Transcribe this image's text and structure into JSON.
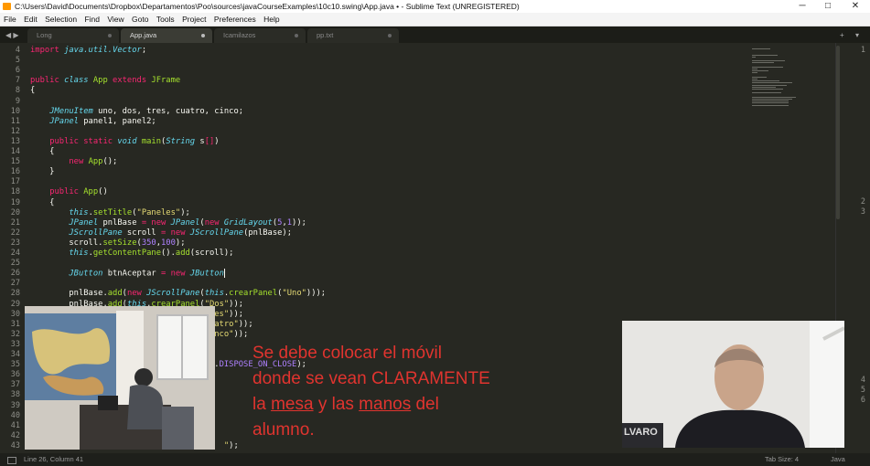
{
  "window": {
    "title": "C:\\Users\\David\\Documents\\Dropbox\\Departamentos\\Poo\\sources\\javaCourseExamples\\10c10.swing\\App.java • - Sublime Text (UNREGISTERED)",
    "minimize": "─",
    "maximize": "□",
    "close": "✕"
  },
  "menu": [
    "File",
    "Edit",
    "Selection",
    "Find",
    "View",
    "Goto",
    "Tools",
    "Project",
    "Preferences",
    "Help"
  ],
  "tabs": [
    {
      "label": "Long",
      "active": false
    },
    {
      "label": "App.java",
      "active": true
    },
    {
      "label": "Icamilazos",
      "active": false
    },
    {
      "label": "pp.txt",
      "active": false
    }
  ],
  "tabnav": {
    "left": "◀ ▶",
    "add": "+",
    "more": "▾"
  },
  "code": [
    {
      "n": "4",
      "parts": [
        [
          "kw",
          "import "
        ],
        [
          "ty",
          "java.util.Vector"
        ],
        [
          "pl",
          ";"
        ]
      ]
    },
    {
      "n": "5",
      "parts": []
    },
    {
      "n": "6",
      "parts": []
    },
    {
      "n": "7",
      "parts": [
        [
          "kw",
          "public "
        ],
        [
          "ty",
          "class "
        ],
        [
          "fn",
          "App "
        ],
        [
          "kw",
          "extends "
        ],
        [
          "fn",
          "JFrame"
        ]
      ]
    },
    {
      "n": "8",
      "parts": [
        [
          "pl",
          "{"
        ]
      ]
    },
    {
      "n": "9",
      "parts": []
    },
    {
      "n": "10",
      "parts": [
        [
          "pl",
          "    "
        ],
        [
          "ty",
          "JMenuItem"
        ],
        [
          "pl",
          " uno, dos, tres, cuatro, cinco;"
        ]
      ]
    },
    {
      "n": "11",
      "parts": [
        [
          "pl",
          "    "
        ],
        [
          "ty",
          "JPanel"
        ],
        [
          "pl",
          " panel1, panel2;"
        ]
      ]
    },
    {
      "n": "12",
      "parts": []
    },
    {
      "n": "13",
      "parts": [
        [
          "pl",
          "    "
        ],
        [
          "kw",
          "public static "
        ],
        [
          "ty",
          "void "
        ],
        [
          "fn",
          "main"
        ],
        [
          "pl",
          "("
        ],
        [
          "ty",
          "String "
        ],
        [
          "pl",
          "s"
        ],
        [
          "kw",
          "[]"
        ],
        [
          "pl",
          ")"
        ]
      ]
    },
    {
      "n": "14",
      "parts": [
        [
          "pl",
          "    {"
        ]
      ]
    },
    {
      "n": "15",
      "parts": [
        [
          "pl",
          "        "
        ],
        [
          "kw",
          "new "
        ],
        [
          "fn",
          "App"
        ],
        [
          "pl",
          "();"
        ]
      ]
    },
    {
      "n": "16",
      "parts": [
        [
          "pl",
          "    }"
        ]
      ]
    },
    {
      "n": "17",
      "parts": []
    },
    {
      "n": "18",
      "parts": [
        [
          "pl",
          "    "
        ],
        [
          "kw",
          "public "
        ],
        [
          "fn",
          "App"
        ],
        [
          "pl",
          "()"
        ]
      ]
    },
    {
      "n": "19",
      "parts": [
        [
          "pl",
          "    {"
        ]
      ]
    },
    {
      "n": "20",
      "parts": [
        [
          "pl",
          "        "
        ],
        [
          "ty",
          "this"
        ],
        [
          "pl",
          "."
        ],
        [
          "fn",
          "setTitle"
        ],
        [
          "pl",
          "("
        ],
        [
          "st",
          "\"Paneles\""
        ],
        [
          "pl",
          ");"
        ]
      ]
    },
    {
      "n": "21",
      "parts": [
        [
          "pl",
          "        "
        ],
        [
          "ty",
          "JPanel"
        ],
        [
          "pl",
          " pnlBase "
        ],
        [
          "kw",
          "= new "
        ],
        [
          "ty",
          "JPanel"
        ],
        [
          "pl",
          "("
        ],
        [
          "kw",
          "new "
        ],
        [
          "ty",
          "GridLayout"
        ],
        [
          "pl",
          "("
        ],
        [
          "nm",
          "5"
        ],
        [
          "pl",
          ","
        ],
        [
          "nm",
          "1"
        ],
        [
          "pl",
          "));"
        ]
      ]
    },
    {
      "n": "22",
      "parts": [
        [
          "pl",
          "        "
        ],
        [
          "ty",
          "JScrollPane"
        ],
        [
          "pl",
          " scroll "
        ],
        [
          "kw",
          "= new "
        ],
        [
          "ty",
          "JScrollPane"
        ],
        [
          "pl",
          "(pnlBase);"
        ]
      ]
    },
    {
      "n": "23",
      "parts": [
        [
          "pl",
          "        scroll."
        ],
        [
          "fn",
          "setSize"
        ],
        [
          "pl",
          "("
        ],
        [
          "nm",
          "350"
        ],
        [
          "pl",
          ","
        ],
        [
          "nm",
          "100"
        ],
        [
          "pl",
          ");"
        ]
      ]
    },
    {
      "n": "24",
      "parts": [
        [
          "pl",
          "        "
        ],
        [
          "ty",
          "this"
        ],
        [
          "pl",
          "."
        ],
        [
          "fn",
          "getContentPane"
        ],
        [
          "pl",
          "()."
        ],
        [
          "fn",
          "add"
        ],
        [
          "pl",
          "(scroll);"
        ]
      ]
    },
    {
      "n": "25",
      "parts": []
    },
    {
      "n": "26",
      "parts": [
        [
          "pl",
          "        "
        ],
        [
          "ty",
          "JButton"
        ],
        [
          "pl",
          " btnAceptar "
        ],
        [
          "kw",
          "= new "
        ],
        [
          "ty",
          "JButton"
        ]
      ],
      "cursor": true
    },
    {
      "n": "27",
      "parts": []
    },
    {
      "n": "28",
      "parts": [
        [
          "pl",
          "        pnlBase."
        ],
        [
          "fn",
          "add"
        ],
        [
          "pl",
          "("
        ],
        [
          "kw",
          "new "
        ],
        [
          "ty",
          "JScrollPane"
        ],
        [
          "pl",
          "("
        ],
        [
          "ty",
          "this"
        ],
        [
          "pl",
          "."
        ],
        [
          "fn",
          "crearPanel"
        ],
        [
          "pl",
          "("
        ],
        [
          "st",
          "\"Uno\""
        ],
        [
          "pl",
          ")));"
        ]
      ]
    },
    {
      "n": "29",
      "parts": [
        [
          "pl",
          "        pnlBase."
        ],
        [
          "fn",
          "add"
        ],
        [
          "pl",
          "("
        ],
        [
          "ty",
          "this"
        ],
        [
          "pl",
          "."
        ],
        [
          "fn",
          "crearPanel"
        ],
        [
          "pl",
          "("
        ],
        [
          "st",
          "\"Dos\""
        ],
        [
          "pl",
          "));"
        ]
      ]
    },
    {
      "n": "30",
      "parts": [
        [
          "pl",
          "                                      "
        ],
        [
          "st",
          "es\""
        ],
        [
          "pl",
          "));"
        ]
      ]
    },
    {
      "n": "31",
      "parts": [
        [
          "pl",
          "                                      "
        ],
        [
          "st",
          "atro\""
        ],
        [
          "pl",
          "));"
        ]
      ]
    },
    {
      "n": "32",
      "parts": [
        [
          "pl",
          "                                      "
        ],
        [
          "st",
          "nco\""
        ],
        [
          "pl",
          "));"
        ]
      ]
    },
    {
      "n": "33",
      "parts": []
    },
    {
      "n": "34",
      "parts": []
    },
    {
      "n": "35",
      "parts": [
        [
          "pl",
          "                                 "
        ],
        [
          "ty",
          "Frame"
        ],
        [
          "pl",
          "."
        ],
        [
          "nm",
          "DISPOSE_ON_CLOSE"
        ],
        [
          "pl",
          ");"
        ]
      ]
    },
    {
      "n": "36",
      "parts": []
    },
    {
      "n": "37",
      "parts": []
    },
    {
      "n": "38",
      "parts": []
    },
    {
      "n": "39",
      "parts": []
    },
    {
      "n": "40",
      "parts": []
    },
    {
      "n": "41",
      "parts": []
    },
    {
      "n": "42",
      "parts": []
    },
    {
      "n": "43",
      "parts": [
        [
          "pl",
          "                                        "
        ],
        [
          "st",
          "\""
        ],
        [
          "pl",
          ");"
        ]
      ]
    }
  ],
  "right_line_numbers": [
    "1",
    "2",
    "3",
    "4",
    "5",
    "6"
  ],
  "overlay_text": {
    "l1": "Se debe colocar el móvil",
    "l2": "donde se vean CLARAMENTE",
    "l3a": "la ",
    "l3b": "mesa",
    "l3c": " y las ",
    "l3d": "manos",
    "l3e": " del",
    "l4": "alumno."
  },
  "webcam_right": {
    "shirt_text": "LVARO"
  },
  "status": {
    "position": "Line 26, Column 41",
    "tab_size": "Tab Size: 4",
    "syntax": "Java"
  },
  "colors": {
    "keyword": "#f92672",
    "type": "#66d9ef",
    "function": "#a6e22e",
    "string": "#e6db74",
    "number": "#ae81ff",
    "overlay": "#e0342f"
  }
}
